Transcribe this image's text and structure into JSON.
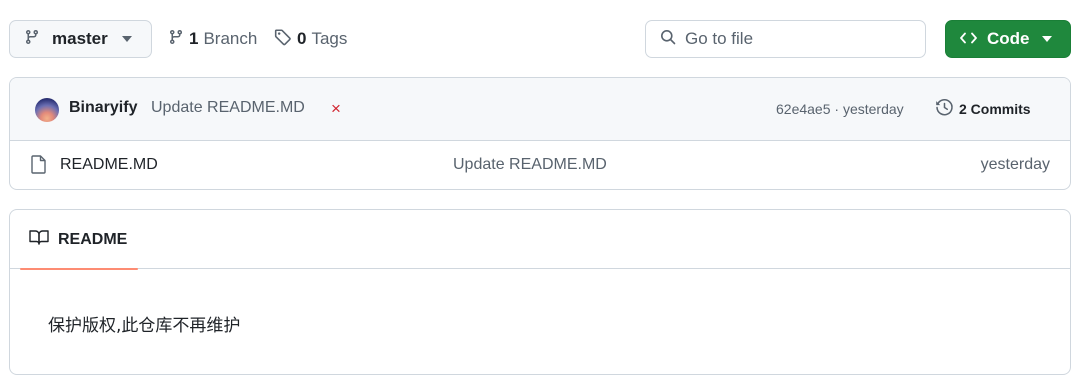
{
  "toolbar": {
    "branch_button": {
      "label": "master",
      "icon": "git-branch-icon"
    },
    "branches": {
      "count": "1",
      "label": "Branch",
      "icon": "git-branch-icon"
    },
    "tags": {
      "count": "0",
      "label": "Tags",
      "icon": "tag-icon"
    },
    "search": {
      "placeholder": "Go to file",
      "value": "",
      "icon": "search-icon"
    },
    "code_button": {
      "label": "Code",
      "icon": "code-icon",
      "color": "#1f883d"
    }
  },
  "latest_commit": {
    "author": "Binaryify",
    "message": "Update README.MD",
    "status": "×",
    "status_color": "#d1242f",
    "sha_time": "62e4ae5 · yesterday",
    "commits": {
      "count_label": "2 Commits",
      "icon": "history-icon"
    }
  },
  "files": [
    {
      "name": "README.MD",
      "icon": "file-icon",
      "message": "Update README.MD",
      "date": "yesterday"
    }
  ],
  "readme": {
    "tab_label": "README",
    "tab_icon": "book-icon",
    "tab_underline_color": "#fd8c73",
    "content": "保护版权,此仓库不再维护"
  }
}
